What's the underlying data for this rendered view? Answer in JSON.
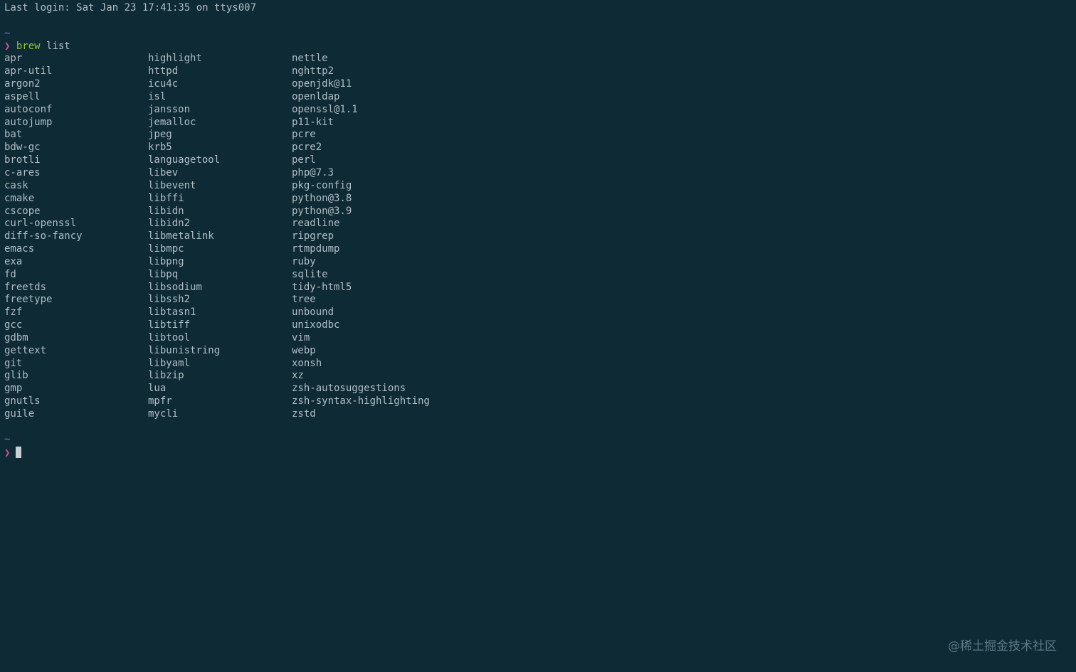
{
  "login_line": "Last login: Sat Jan 23 17:41:35 on ttys007",
  "prompt": {
    "dir": "~",
    "symbol": "❯",
    "command": "brew",
    "args": " list"
  },
  "columns": [
    [
      "apr",
      "apr-util",
      "argon2",
      "aspell",
      "autoconf",
      "autojump",
      "bat",
      "bdw-gc",
      "brotli",
      "c-ares",
      "cask",
      "cmake",
      "cscope",
      "curl-openssl",
      "diff-so-fancy",
      "emacs",
      "exa",
      "fd",
      "freetds",
      "freetype",
      "fzf",
      "gcc",
      "gdbm",
      "gettext",
      "git",
      "glib",
      "gmp",
      "gnutls",
      "guile"
    ],
    [
      "highlight",
      "httpd",
      "icu4c",
      "isl",
      "jansson",
      "jemalloc",
      "jpeg",
      "krb5",
      "languagetool",
      "libev",
      "libevent",
      "libffi",
      "libidn",
      "libidn2",
      "libmetalink",
      "libmpc",
      "libpng",
      "libpq",
      "libsodium",
      "libssh2",
      "libtasn1",
      "libtiff",
      "libtool",
      "libunistring",
      "libyaml",
      "libzip",
      "lua",
      "mpfr",
      "mycli"
    ],
    [
      "nettle",
      "nghttp2",
      "openjdk@11",
      "openldap",
      "openssl@1.1",
      "p11-kit",
      "pcre",
      "pcre2",
      "perl",
      "php@7.3",
      "pkg-config",
      "python@3.8",
      "python@3.9",
      "readline",
      "ripgrep",
      "rtmpdump",
      "ruby",
      "sqlite",
      "tidy-html5",
      "tree",
      "unbound",
      "unixodbc",
      "vim",
      "webp",
      "xonsh",
      "xz",
      "zsh-autosuggestions",
      "zsh-syntax-highlighting",
      "zstd"
    ]
  ],
  "prompt2": {
    "dir": "~",
    "symbol": "❯"
  },
  "watermark": "@稀土掘金技术社区",
  "colors": {
    "background": "#0e2a35",
    "text": "#b0bec5",
    "dir": "#4a90c8",
    "arrow": "#d3529a",
    "command": "#8fc53c"
  }
}
